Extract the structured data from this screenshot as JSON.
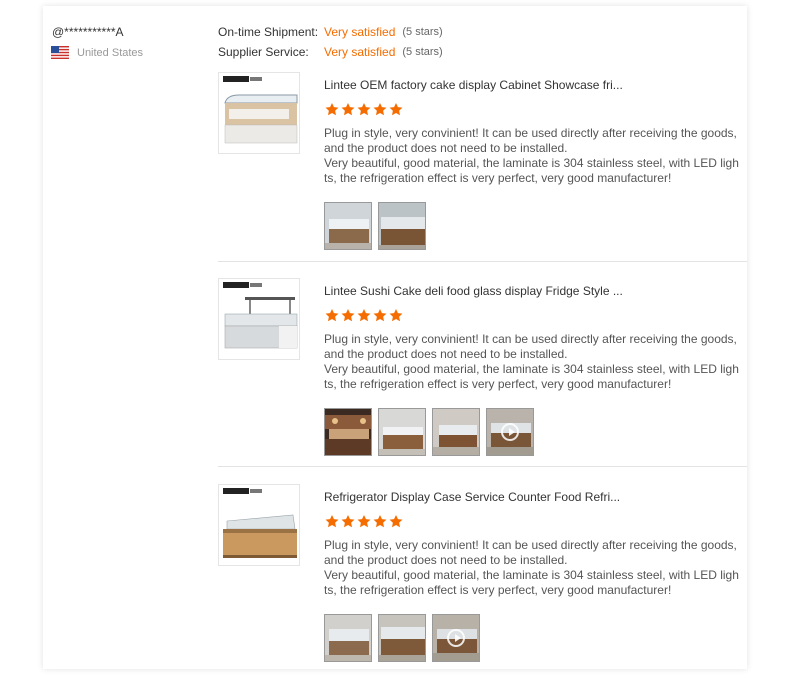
{
  "user": {
    "name": "@***********A",
    "country": "United States",
    "flag_icon": "us-flag-icon"
  },
  "ratings": [
    {
      "label": "On-time Shipment:",
      "value": "Very satisfied",
      "stars": "(5 stars)"
    },
    {
      "label": "Supplier Service:",
      "value": "Very satisfied",
      "stars": "(5 stars)"
    }
  ],
  "colors": {
    "accent": "#f56c00",
    "star": "#f56c00"
  },
  "reviews": [
    {
      "title": "Lintee OEM factory cake display Cabinet Showcase fri...",
      "rating": 5,
      "text_line1": "Plug in style, very convinient! It can be used directly after receiving the goods, and the product does not need to be installed.",
      "text_line2": "Very beautiful, good material, the laminate is 304 stainless steel, with LED lights, the refrigeration effect is very perfect, very good manufacturer!",
      "photos": [
        {
          "type": "image"
        },
        {
          "type": "image"
        }
      ]
    },
    {
      "title": "Lintee Sushi Cake deli food glass display Fridge Style ...",
      "rating": 5,
      "text_line1": "Plug in style, very convinient! It can be used directly after receiving the goods, and the product does not need to be installed.",
      "text_line2": "Very beautiful, good material, the laminate is 304 stainless steel, with LED lights, the refrigeration effect is very perfect, very good manufacturer!",
      "photos": [
        {
          "type": "image"
        },
        {
          "type": "image"
        },
        {
          "type": "image"
        },
        {
          "type": "video"
        }
      ]
    },
    {
      "title": "Refrigerator Display Case Service Counter Food Refri...",
      "rating": 5,
      "text_line1": "Plug in style, very convinient! It can be used directly after receiving the goods, and the product does not need to be installed.",
      "text_line2": "Very beautiful, good material, the laminate is 304 stainless steel, with LED lights, the refrigeration effect is very perfect, very good manufacturer!",
      "photos": [
        {
          "type": "image"
        },
        {
          "type": "image"
        },
        {
          "type": "video"
        }
      ]
    }
  ]
}
